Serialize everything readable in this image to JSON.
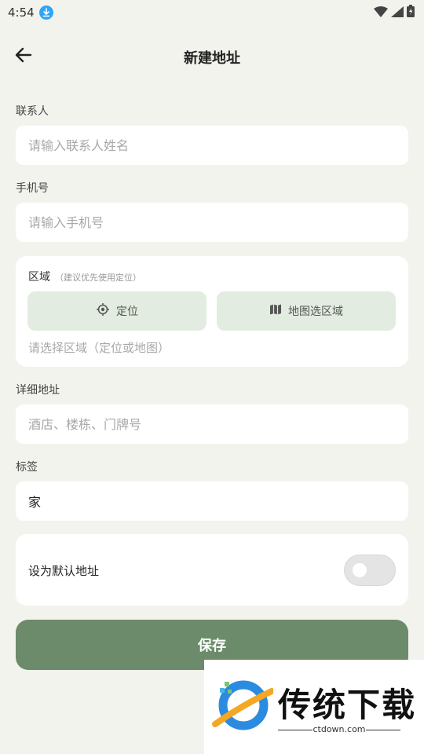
{
  "status_bar": {
    "time": "4:54"
  },
  "header": {
    "title": "新建地址"
  },
  "contact": {
    "label": "联系人",
    "placeholder": "请输入联系人姓名"
  },
  "phone": {
    "label": "手机号",
    "placeholder": "请输入手机号"
  },
  "region": {
    "label": "区域",
    "hint": "（建议优先使用定位）",
    "locate_label": "定位",
    "map_label": "地图选区域",
    "placeholder": "请选择区域（定位或地图）"
  },
  "address": {
    "label": "详细地址",
    "placeholder": "酒店、楼栋、门牌号"
  },
  "tag": {
    "label": "标签",
    "value": "家"
  },
  "default_address": {
    "label": "设为默认地址",
    "enabled": false
  },
  "save_label": "保存",
  "watermark": {
    "brand": "传统下载",
    "url": "ctdown.com"
  },
  "colors": {
    "accent": "#6c8b6b",
    "button_bg": "#e3ece0",
    "page_bg": "#f3f3ee"
  }
}
